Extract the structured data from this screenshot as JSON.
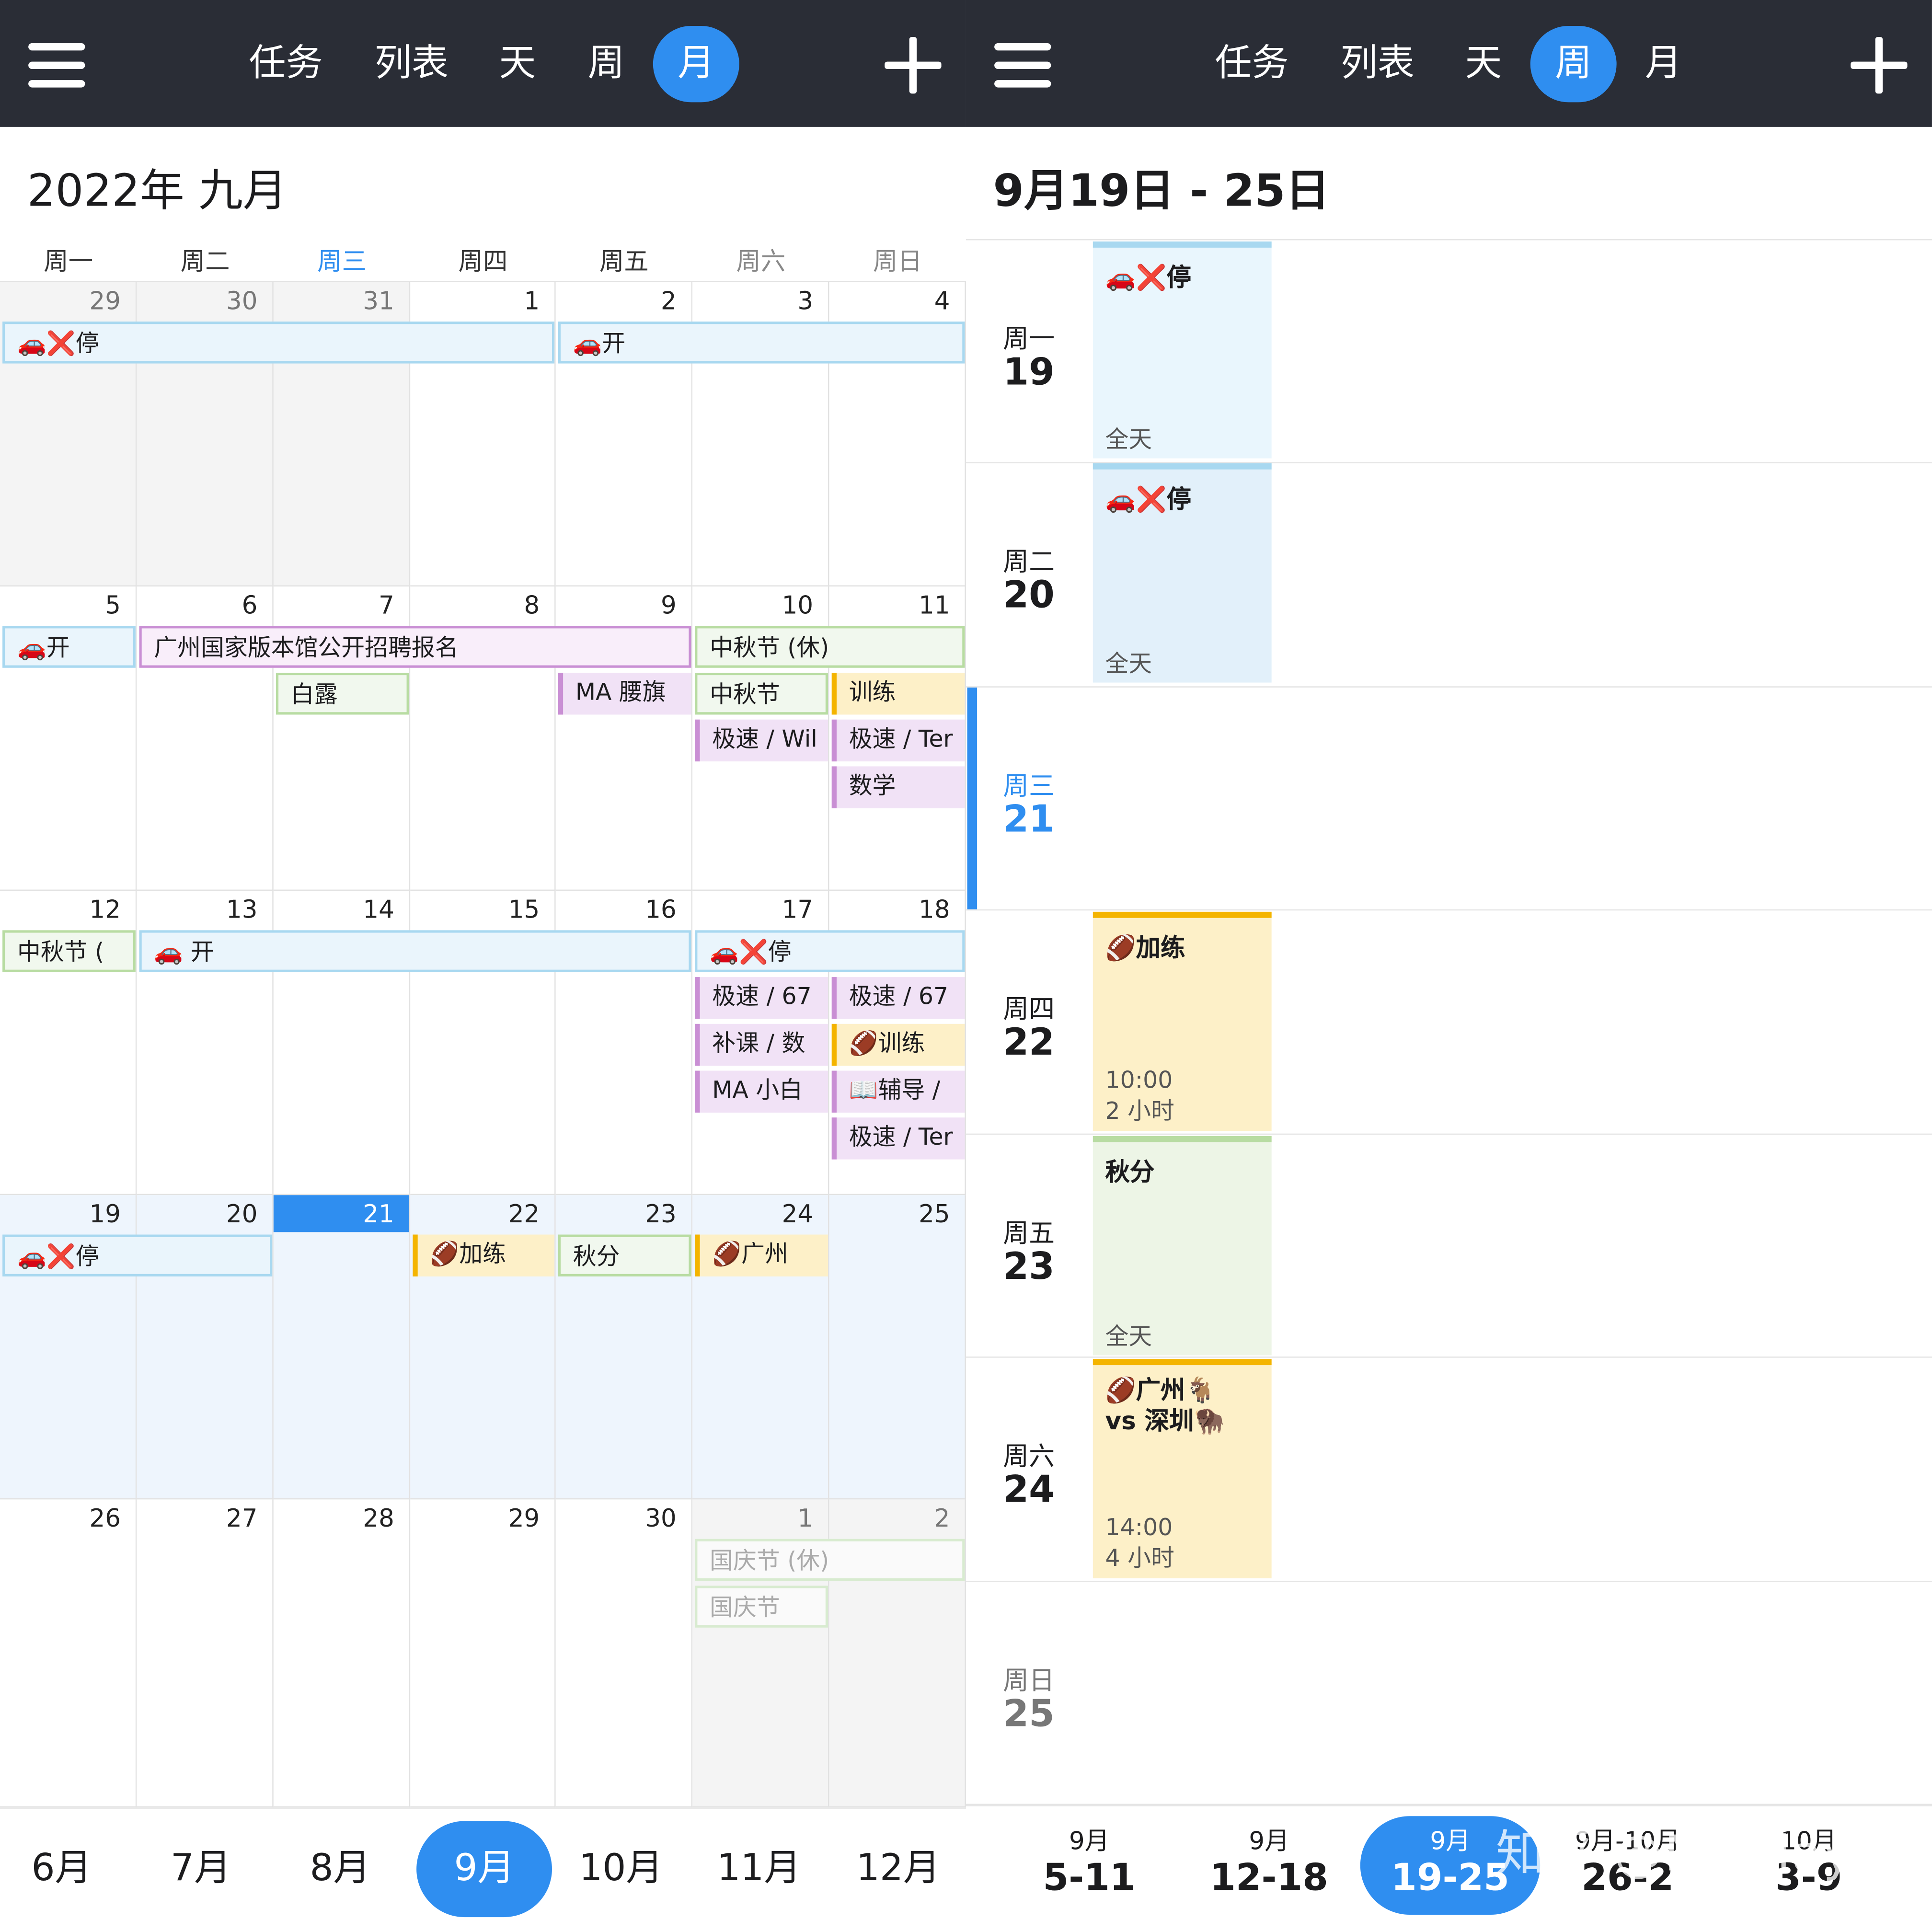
{
  "left": {
    "tabs": [
      "任务",
      "列表",
      "天",
      "周",
      "月"
    ],
    "title": "2022年 九月",
    "weekdays": [
      "周一",
      "周二",
      "周三",
      "周四",
      "周五",
      "周六",
      "周日"
    ],
    "days": [
      [
        "29",
        "30",
        "31",
        "1",
        "2",
        "3",
        "4"
      ],
      [
        "5",
        "6",
        "7",
        "8",
        "9",
        "10",
        "11"
      ],
      [
        "12",
        "13",
        "14",
        "15",
        "16",
        "17",
        "18"
      ],
      [
        "19",
        "20",
        "21",
        "22",
        "23",
        "24",
        "25"
      ],
      [
        "26",
        "27",
        "28",
        "29",
        "30",
        "1",
        "2"
      ]
    ],
    "events": {
      "w1a": "🚗❌停",
      "w1b": "🚗开",
      "w2a": "🚗开",
      "w2b": "广州国家版本馆公开招聘报名",
      "w2c": "中秋节 (休)",
      "w2d": "白露",
      "w2e": "MA 腰旗",
      "w2f": "中秋节",
      "w2g": "训练",
      "w2h": "极速 / Wil",
      "w2i": "极速 / Ter",
      "w2j": "数学",
      "w3a": "中秋节 (",
      "w3b": "🚗 开",
      "w3c": "🚗❌停",
      "w3d": "极速 / 67",
      "w3e": "极速 / 67",
      "w3f": "补课 / 数",
      "w3g": "🏈训练",
      "w3h": "MA 小白",
      "w3i": "📖辅导 /",
      "w3j": "极速 / Ter",
      "w4a": "🚗❌停",
      "w4b": "🏈加练",
      "w4c": "秋分",
      "w4d": "🏈广州",
      "w5a": "国庆节 (休)",
      "w5b": "国庆节"
    },
    "months": [
      "6月",
      "7月",
      "8月",
      "9月",
      "10月",
      "11月",
      "12月"
    ]
  },
  "right": {
    "tabs": [
      "任务",
      "列表",
      "天",
      "周",
      "月"
    ],
    "title": "9月19日 - 25日",
    "days": [
      {
        "w": "周一",
        "d": "19"
      },
      {
        "w": "周二",
        "d": "20"
      },
      {
        "w": "周三",
        "d": "21"
      },
      {
        "w": "周四",
        "d": "22"
      },
      {
        "w": "周五",
        "d": "23"
      },
      {
        "w": "周六",
        "d": "24"
      },
      {
        "w": "周日",
        "d": "25"
      }
    ],
    "blocks": {
      "mon_t": "🚗❌停",
      "mon_b": "全天",
      "tue_t": "🚗❌停",
      "tue_b": "全天",
      "thu_t": "🏈加练",
      "thu_b1": "10:00",
      "thu_b2": "2 小时",
      "fri_t": "秋分",
      "fri_b": "全天",
      "sat_t1": "🏈广州🐐",
      "sat_t2": "vs 深圳🦬",
      "sat_b1": "14:00",
      "sat_b2": "4 小时"
    },
    "weeks": [
      {
        "a": "9月",
        "b": "5-11"
      },
      {
        "a": "9月",
        "b": "12-18"
      },
      {
        "a": "9月",
        "b": "19-25"
      },
      {
        "a": "9月-10月",
        "b": "26-2"
      },
      {
        "a": "10月",
        "b": "3-9"
      }
    ],
    "watermark": "知乎 @Nikolay"
  },
  "colors": {
    "accent": "#2f8ef0",
    "topbar": "#2a2d36"
  }
}
